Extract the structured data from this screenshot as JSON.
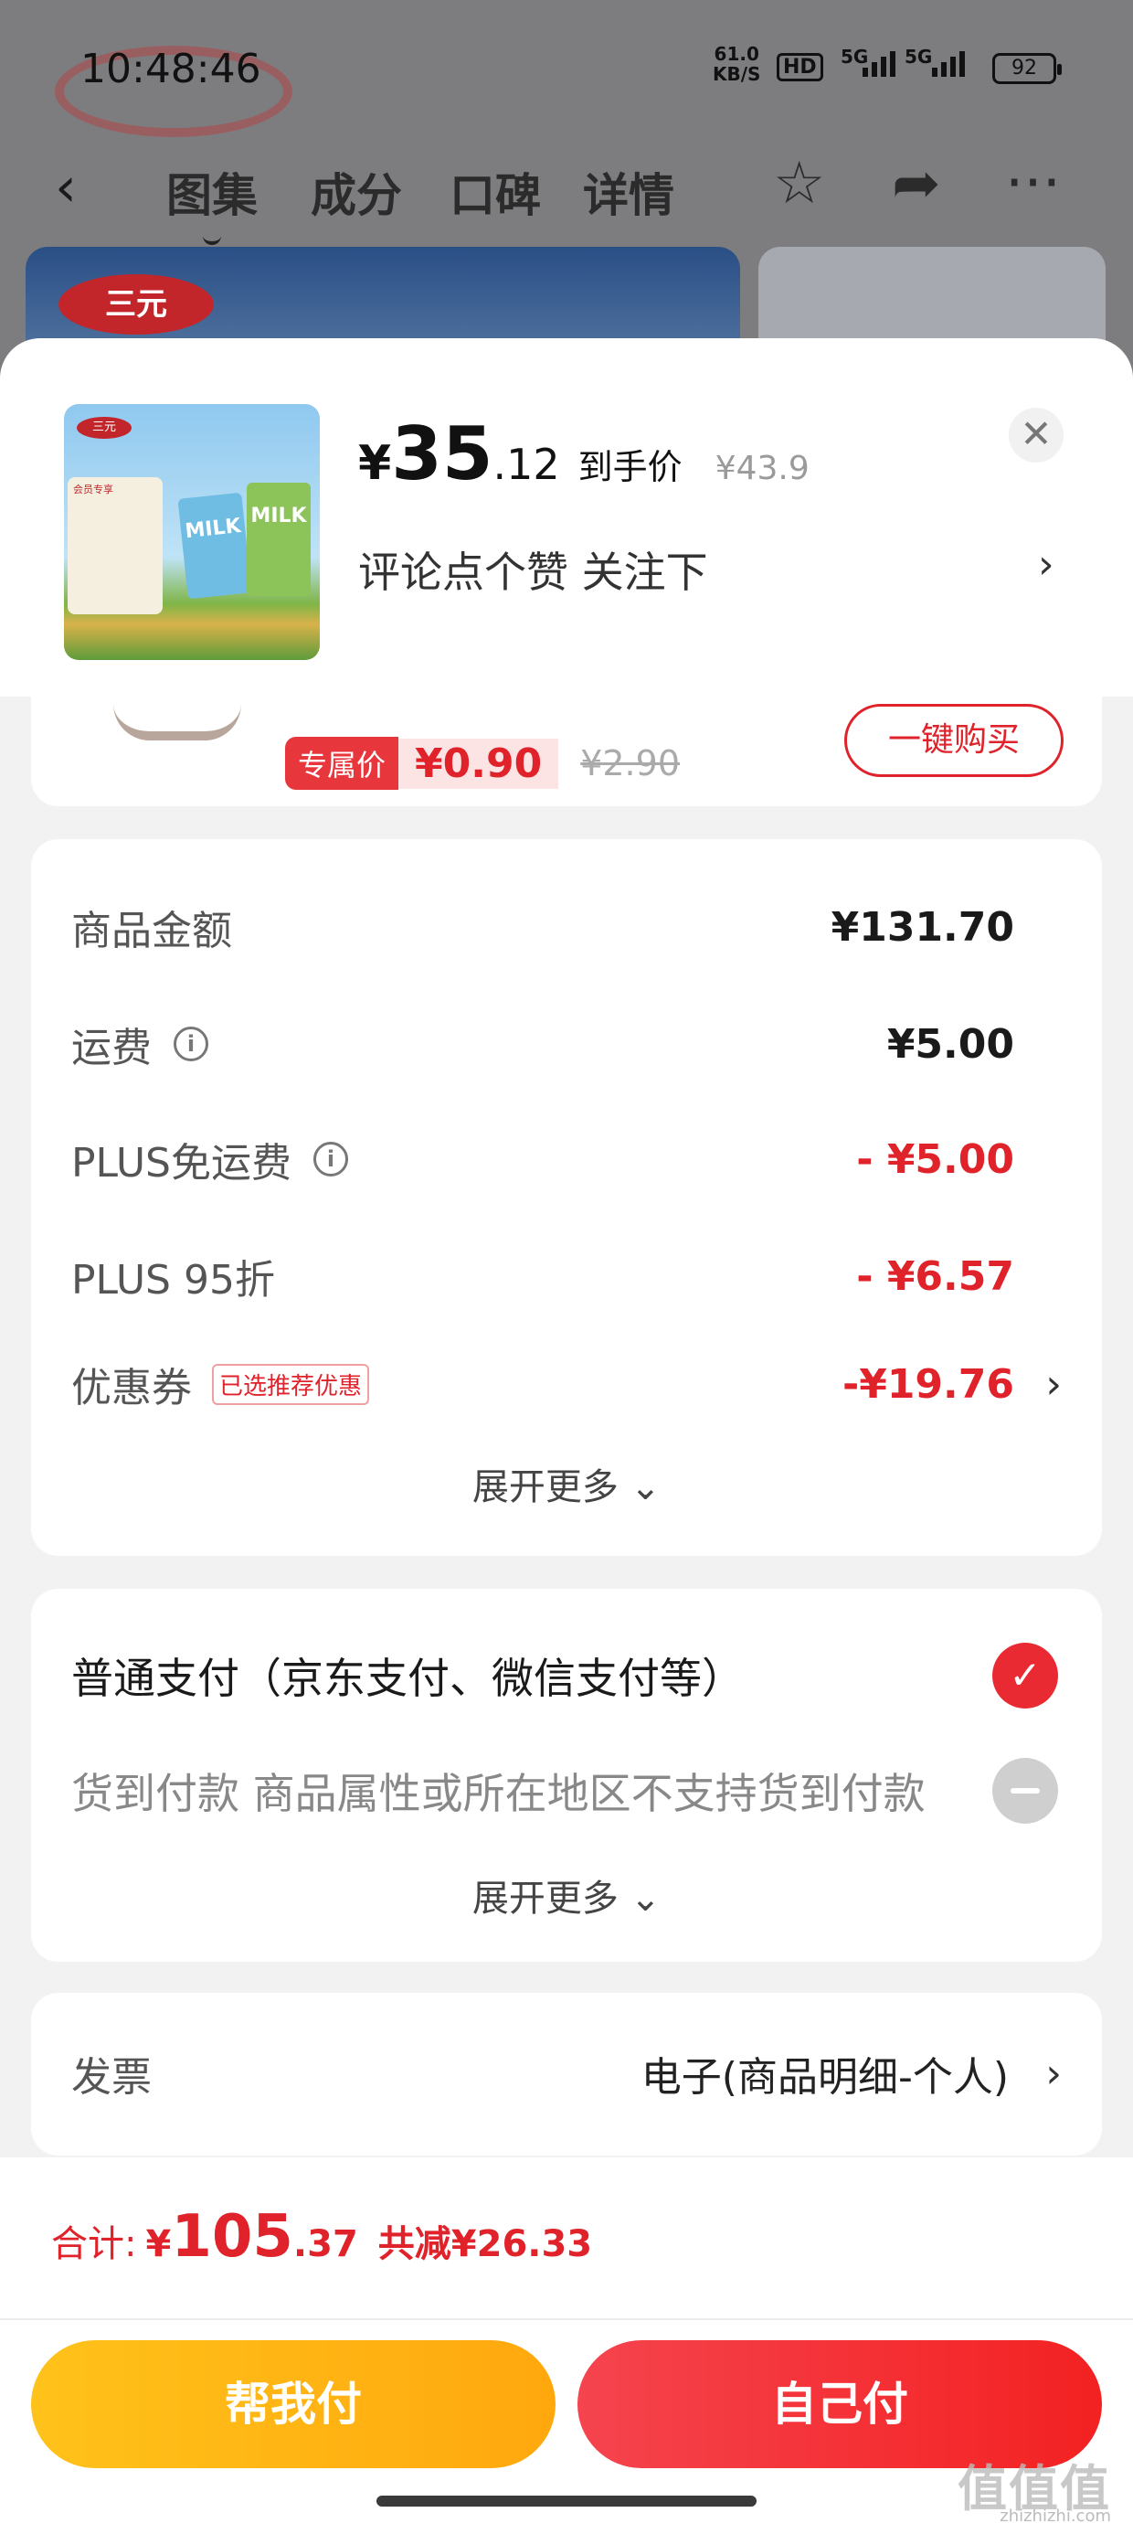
{
  "status_bar": {
    "time": "10:48:46",
    "net_speed": "61.0",
    "net_unit": "KB/S",
    "hd": "HD",
    "sig1": "5G",
    "sig2": "5G",
    "battery": "92"
  },
  "background": {
    "tabs": [
      "图集",
      "成分",
      "口碑",
      "详情"
    ],
    "brand_logo": "三元"
  },
  "sheet": {
    "product_thumb_brand": "三元",
    "product_thumb_card": "会员专享",
    "product_thumb_text": "MILK",
    "price_yen": "¥",
    "price_int": "35",
    "price_dec": ".12",
    "price_tag": "到手价",
    "original_price": "¥43.9",
    "follow_text": "评论点个赞  关注下",
    "close_icon": "close-icon"
  },
  "product_card": {
    "exclusive_label": "专属价",
    "exclusive_price": "¥0.90",
    "old_price": "¥2.90",
    "buy_button": "一键购买"
  },
  "amounts": {
    "rows": [
      {
        "label": "商品金额",
        "value": "¥131.70"
      },
      {
        "label": "运费",
        "value": "¥5.00"
      },
      {
        "label": "PLUS免运费",
        "value": "- ¥5.00"
      },
      {
        "label": "PLUS 95折",
        "value": "- ¥6.57"
      },
      {
        "label": "优惠券",
        "badge": "已选推荐优惠",
        "value": "-¥19.76"
      }
    ],
    "expand": "展开更多 ⌄"
  },
  "payment": {
    "normal": "普通支付（京东支付、微信支付等）",
    "cod": "货到付款  商品属性或所在地区不支持货到付款",
    "expand": "展开更多 ⌄"
  },
  "invoice": {
    "label": "发票",
    "value": "电子(商品明细-个人)"
  },
  "footer": {
    "total_label": "合计:",
    "total_yen": "¥",
    "total_int": "105",
    "total_dec": ".37",
    "saved": "共减¥26.33",
    "help_pay": "帮我付",
    "self_pay": "自己付"
  },
  "watermark": {
    "logo": "值值值",
    "site": "zhizhizhi.com"
  },
  "colors": {
    "accent_red": "#e0232b",
    "button_yellow": "#ffb514",
    "button_red": "#f3353d"
  }
}
